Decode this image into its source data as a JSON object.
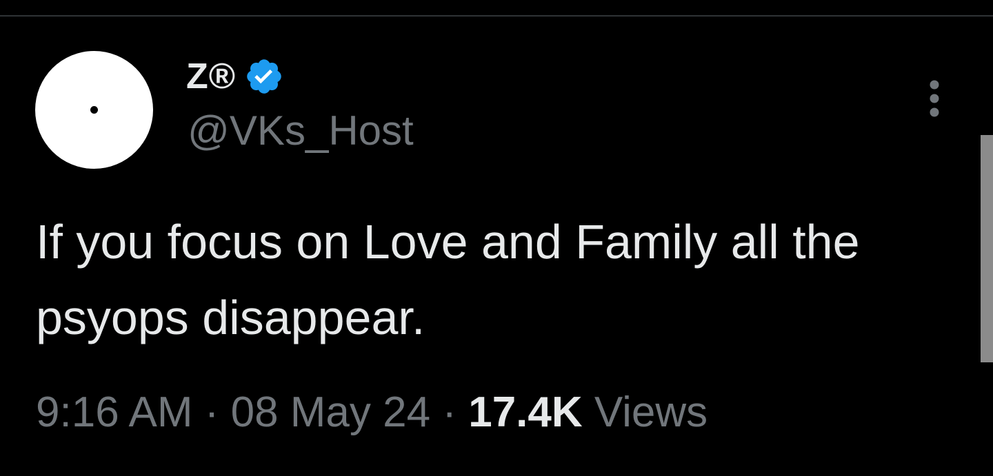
{
  "user": {
    "display_name": "Z®",
    "handle": "@VKs_Host",
    "verified": true,
    "verified_icon": "verified-badge-icon",
    "avatar": "white-circle-with-black-dot"
  },
  "tweet": {
    "text": "If you focus on Love and Family all the psyops disappear.",
    "time": "9:16 AM",
    "separator": "·",
    "date": "08 May 24",
    "views_count": "17.4K",
    "views_label": "Views"
  },
  "controls": {
    "more_icon": "more-vertical-icon"
  },
  "colors": {
    "background": "#000000",
    "primary_text": "#e7e9ea",
    "secondary_text": "#71767b",
    "verified_blue": "#1d9bf0",
    "divider": "#2f3336"
  }
}
